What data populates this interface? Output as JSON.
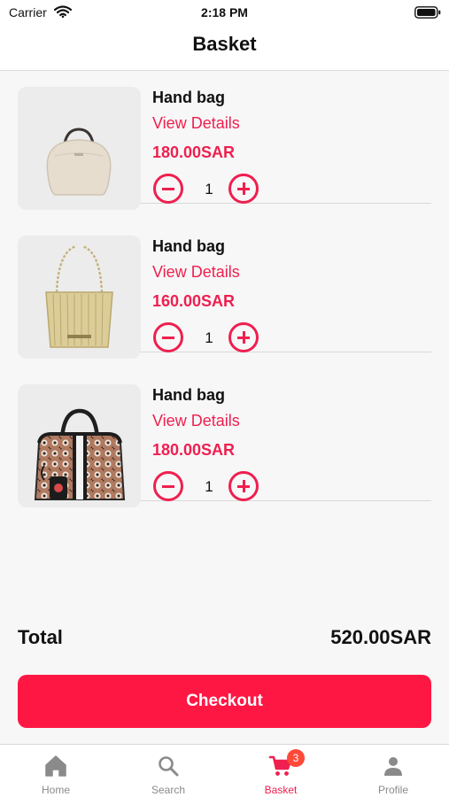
{
  "status_bar": {
    "carrier": "Carrier",
    "time": "2:18 PM"
  },
  "header": {
    "title": "Basket"
  },
  "items": [
    {
      "name": "Hand bag",
      "details_label": "View Details",
      "price": "180.00SAR",
      "quantity": "1",
      "image": "beige-handbag"
    },
    {
      "name": "Hand bag",
      "details_label": "View Details",
      "price": "160.00SAR",
      "quantity": "1",
      "image": "gold-pleated-tote"
    },
    {
      "name": "Hand bag",
      "details_label": "View Details",
      "price": "180.00SAR",
      "quantity": "1",
      "image": "patterned-black-handbag"
    }
  ],
  "summary": {
    "total_label": "Total",
    "total_value": "520.00SAR"
  },
  "checkout": {
    "label": "Checkout"
  },
  "tabbar": {
    "tabs": [
      {
        "label": "Home",
        "icon": "home-icon"
      },
      {
        "label": "Search",
        "icon": "search-icon"
      },
      {
        "label": "Basket",
        "icon": "cart-icon",
        "badge": "3",
        "active": true
      },
      {
        "label": "Profile",
        "icon": "person-icon"
      }
    ]
  },
  "colors": {
    "accent": "#ef1f4f",
    "checkout_bg": "#ff1744",
    "badge_bg": "#ff4a3a"
  }
}
